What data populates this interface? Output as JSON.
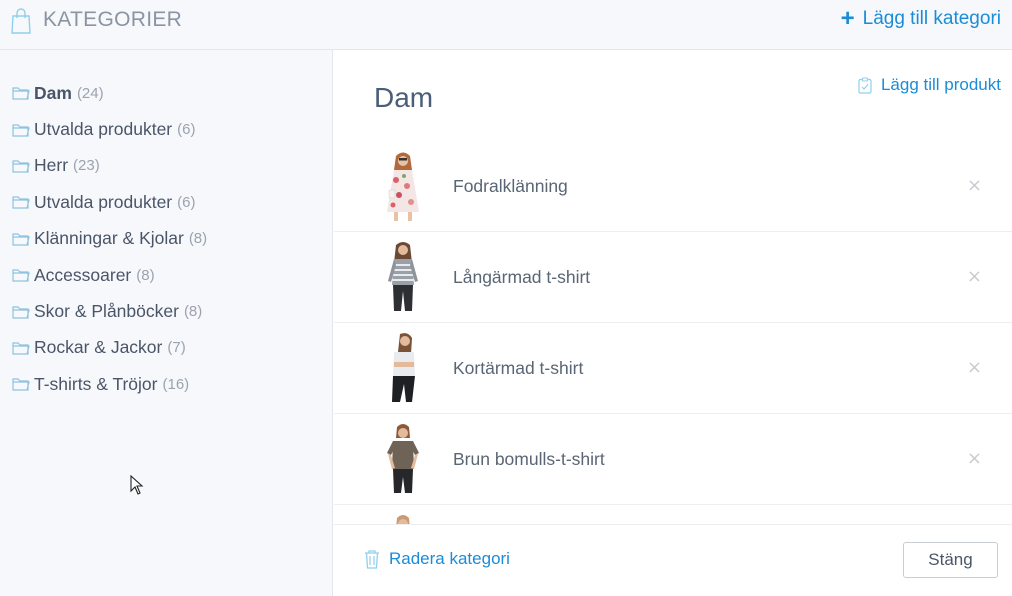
{
  "header": {
    "title": "KATEGORIER",
    "add_category_label": "Lägg till kategori"
  },
  "sidebar": {
    "items": [
      {
        "label": "Dam",
        "count": "(24)",
        "active": true
      },
      {
        "label": "Utvalda produkter",
        "count": "(6)"
      },
      {
        "label": "Herr",
        "count": "(23)"
      },
      {
        "label": "Utvalda produkter",
        "count": "(6)"
      },
      {
        "label": "Klänningar & Kjolar",
        "count": "(8)"
      },
      {
        "label": "Accessoarer",
        "count": "(8)"
      },
      {
        "label": "Skor & Plånböcker",
        "count": "(8)"
      },
      {
        "label": "Rockar & Jackor",
        "count": "(7)"
      },
      {
        "label": "T-shirts & Tröjor",
        "count": "(16)"
      }
    ]
  },
  "main": {
    "category_title": "Dam",
    "add_product_label": "Lägg till produkt",
    "products": [
      {
        "name": "Fodralklänning",
        "remove": "×"
      },
      {
        "name": "Långärmad t-shirt",
        "remove": "×"
      },
      {
        "name": "Kortärmad t-shirt",
        "remove": "×"
      },
      {
        "name": "Brun bomulls-t-shirt",
        "remove": "×"
      }
    ]
  },
  "footer": {
    "delete_label": "Radera kategori",
    "close_label": "Stäng"
  },
  "colors": {
    "accent": "#1a8cd8",
    "sidebar_bg": "#f7f8fb",
    "text": "#4a5568",
    "muted": "#9aa3ae"
  },
  "icons": [
    "shopping-bag-icon",
    "plus-icon",
    "folder-icon",
    "clipboard-icon",
    "trash-icon",
    "close-icon",
    "mouse-cursor-icon"
  ]
}
